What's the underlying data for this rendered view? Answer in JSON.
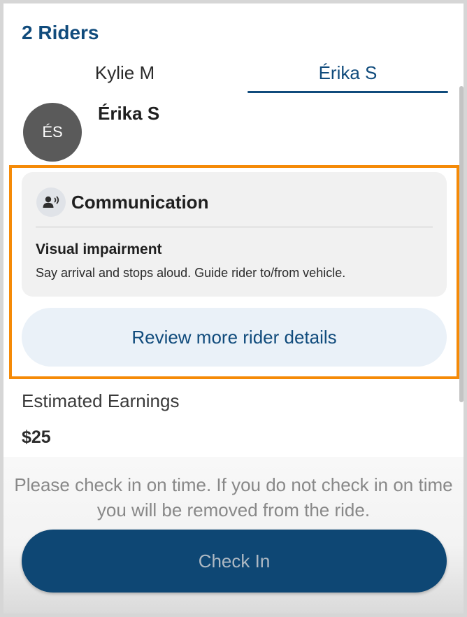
{
  "header": {
    "title": "2 Riders"
  },
  "tabs": [
    {
      "label": "Kylie M",
      "active": false
    },
    {
      "label": "Érika S",
      "active": true
    }
  ],
  "rider": {
    "initials": "ÉS",
    "name": "Érika S"
  },
  "communication": {
    "heading": "Communication",
    "icon": "speaking-person-icon",
    "need_title": "Visual impairment",
    "need_description": "Say arrival and stops aloud. Guide rider to/from vehicle."
  },
  "review_button_label": "Review more rider details",
  "earnings": {
    "label": "Estimated Earnings",
    "value": "$25"
  },
  "checkin": {
    "note": "Please check in on time. If you do not check in on time you will be removed from the ride.",
    "button_label": "Check In"
  },
  "colors": {
    "brand": "#104b7c",
    "highlight": "#f58a07",
    "checkin_button": "#0e4774",
    "avatar": "#5a5a5a"
  }
}
